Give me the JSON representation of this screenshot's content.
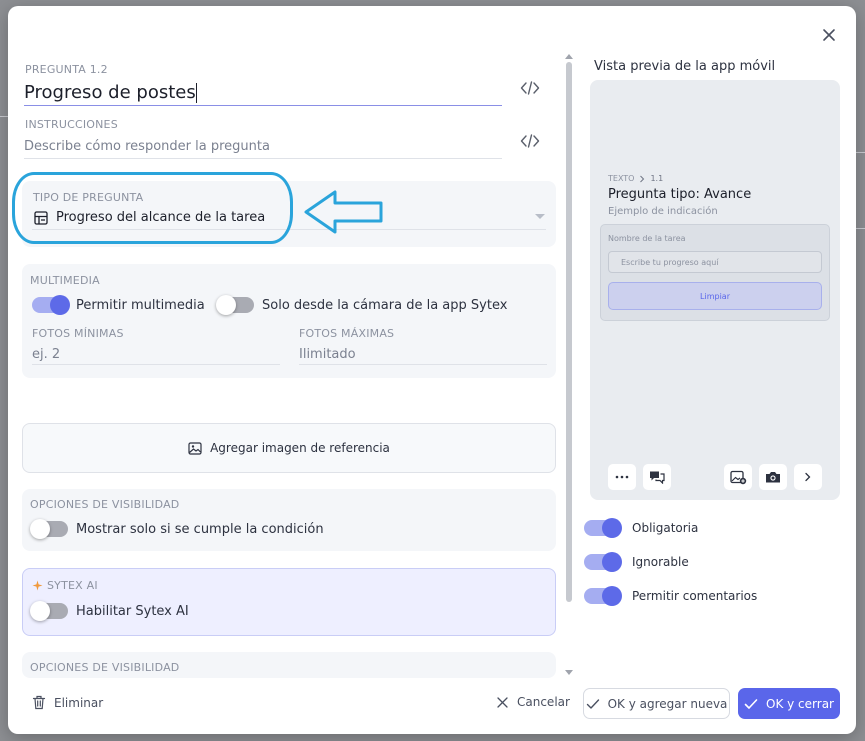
{
  "question": {
    "number_label": "PREGUNTA 1.2",
    "title_value": "Progreso de postes",
    "instructions_label": "INSTRUCCIONES",
    "instructions_placeholder": "Describe cómo responder la pregunta"
  },
  "question_type": {
    "label": "TIPO DE PREGUNTA",
    "value": "Progreso del alcance de la tarea"
  },
  "multimedia": {
    "label": "MULTIMEDIA",
    "allow_label": "Permitir multimedia",
    "allow_on": true,
    "camera_only_label": "Solo desde la cámara de la app Sytex",
    "camera_only_on": false,
    "min_photos_label": "FOTOS MÍNIMAS",
    "min_photos_placeholder": "ej. 2",
    "max_photos_label": "FOTOS MÁXIMAS",
    "max_photos_placeholder": "Ilimitado"
  },
  "reference_image": {
    "label": "Agregar imagen de referencia"
  },
  "visibility": {
    "label": "OPCIONES DE VISIBILIDAD",
    "condition_label": "Mostrar solo si se cumple la condición",
    "condition_on": false
  },
  "sytex_ai": {
    "label": "SYTEX AI",
    "enable_label": "Habilitar Sytex AI",
    "enable_on": false
  },
  "visibility2": {
    "label": "OPCIONES DE VISIBILIDAD"
  },
  "footer": {
    "delete_label": "Eliminar",
    "cancel_label": "Cancelar",
    "ok_add_label": "OK y agregar nueva",
    "ok_close_label": "OK y cerrar"
  },
  "preview": {
    "title": "Vista previa de la app móvil",
    "crumb_category": "TEXTO",
    "crumb_number": "1.1",
    "question_title": "Pregunta tipo: Avance",
    "question_hint": "Ejemplo de indicación",
    "field_label": "Nombre de la tarea",
    "field_placeholder": "Escribe tu progreso aquí",
    "clear_label": "Limpiar"
  },
  "settings": {
    "required_label": "Obligatoria",
    "required_on": true,
    "skippable_label": "Ignorable",
    "skippable_on": true,
    "comments_label": "Permitir comentarios",
    "comments_on": true
  },
  "colors": {
    "accent": "#5a66ea",
    "annotation": "#2aa4db"
  }
}
